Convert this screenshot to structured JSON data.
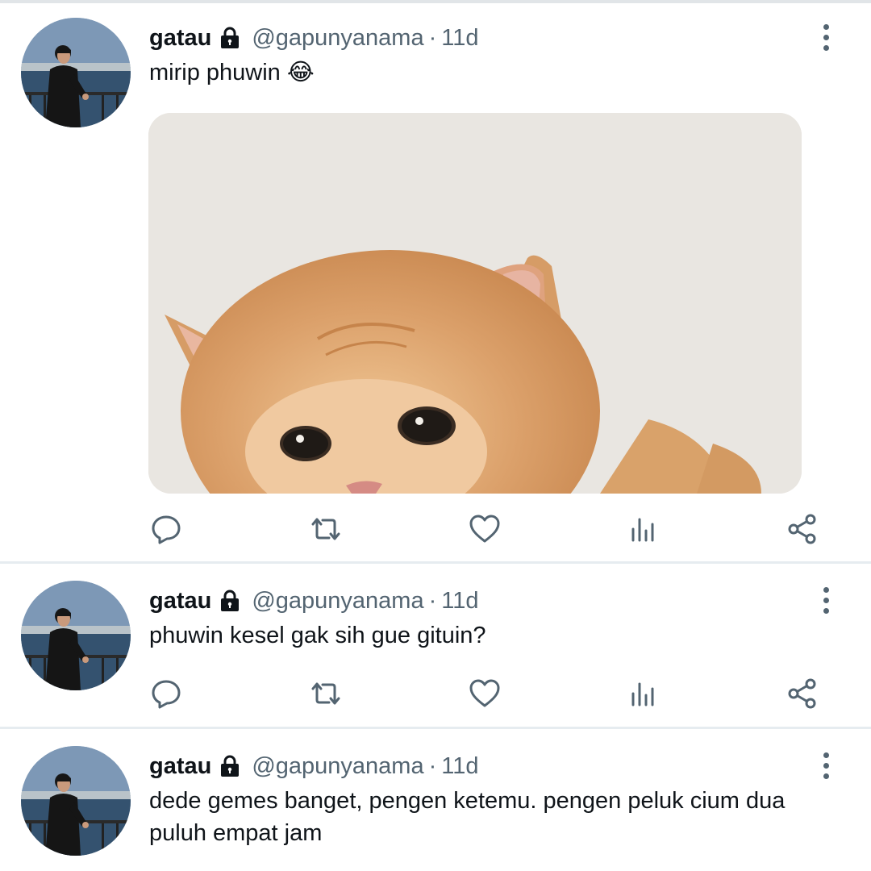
{
  "tweets": [
    {
      "name": "gatau",
      "handle": "@gapunyanama",
      "separator": "·",
      "time": "11d",
      "text": "mirip phuwin 😂",
      "has_media": true
    },
    {
      "name": "gatau",
      "handle": "@gapunyanama",
      "separator": "·",
      "time": "11d",
      "text": "phuwin kesel gak sih gue gituin?",
      "has_media": false
    },
    {
      "name": "gatau",
      "handle": "@gapunyanama",
      "separator": "·",
      "time": "11d",
      "text": "dede gemes banget, pengen ketemu. pengen peluk cium dua puluh empat jam",
      "has_media": false
    }
  ],
  "icons": {
    "reply": "reply-icon",
    "retweet": "retweet-icon",
    "like": "heart-icon",
    "views": "views-icon",
    "share": "share-icon",
    "locked": "lock-icon",
    "more": "more-vertical-icon"
  },
  "colors": {
    "icon": "#536471",
    "text": "#0f1419",
    "secondary": "#536471",
    "divider": "#e6ecf0"
  }
}
